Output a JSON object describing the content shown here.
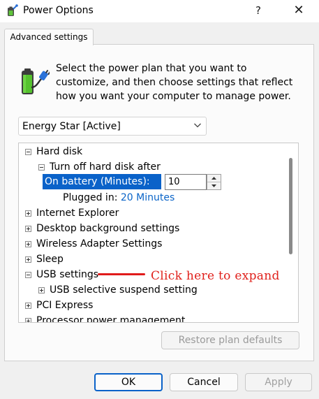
{
  "window": {
    "title": "Power Options",
    "help_label": "?",
    "close_label": "✕"
  },
  "tab": {
    "label": "Advanced settings"
  },
  "description": "Select the power plan that you want to customize, and then choose settings that reflect how you want your computer to manage power.",
  "plan_select": {
    "selected": "Energy Star [Active]"
  },
  "tree": {
    "hard_disk": "Hard disk",
    "turn_off_after": "Turn off hard disk after",
    "on_battery_label": "On battery (Minutes):",
    "on_battery_value": "10",
    "plugged_in_label": "Plugged in:",
    "plugged_in_value": "20 Minutes",
    "internet_explorer": "Internet Explorer",
    "desktop_background": "Desktop background settings",
    "wireless_adapter": "Wireless Adapter Settings",
    "sleep": "Sleep",
    "usb_settings": "USB settings",
    "usb_selective_suspend": "USB selective suspend setting",
    "pci_express": "PCI Express",
    "processor_power": "Processor power management"
  },
  "annotation": {
    "text": "Click here to expand",
    "color": "#e0201b"
  },
  "buttons": {
    "restore": "Restore plan defaults",
    "ok": "OK",
    "cancel": "Cancel",
    "apply": "Apply"
  },
  "colors": {
    "selection": "#0a62c9",
    "link": "#0a64c8"
  },
  "icons": [
    "power-options-icon",
    "battery-plug-icon",
    "chevron-down-icon",
    "expand-icon",
    "collapse-icon",
    "spin-up-icon",
    "spin-down-icon"
  ]
}
